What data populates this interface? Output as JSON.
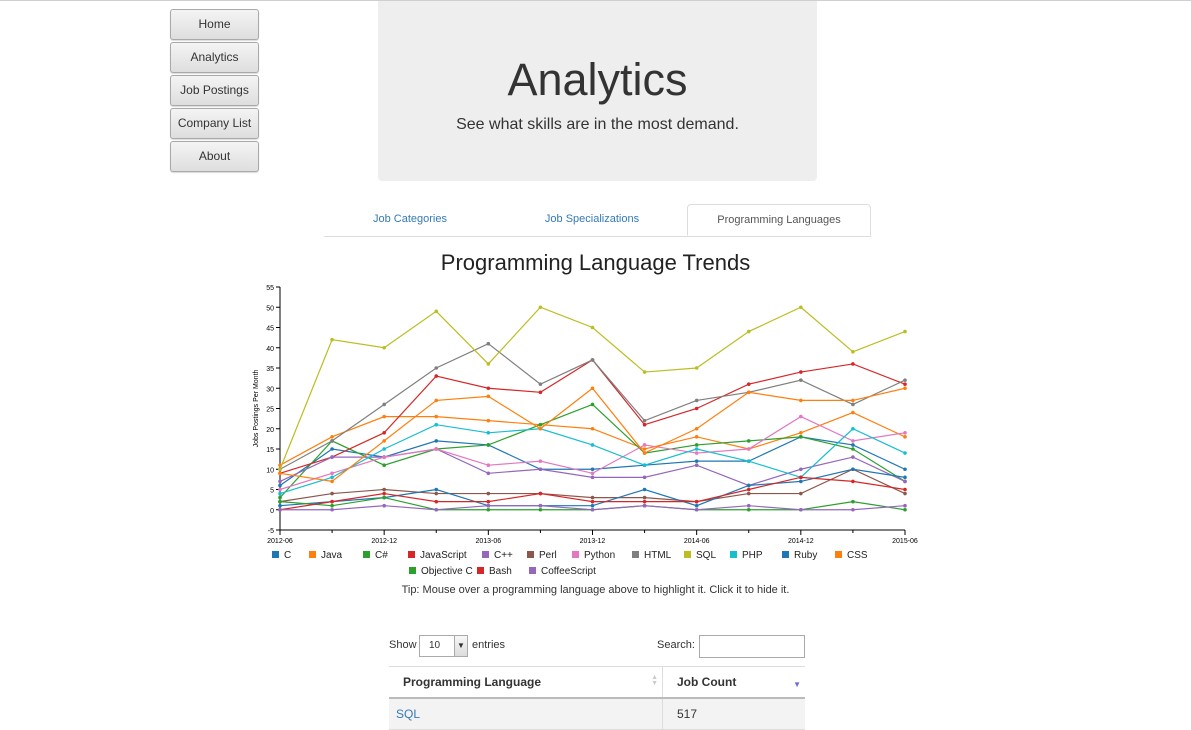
{
  "nav": {
    "items": [
      "Home",
      "Analytics",
      "Job Postings",
      "Company List",
      "About"
    ]
  },
  "hero": {
    "title": "Analytics",
    "subtitle": "See what skills are in the most demand."
  },
  "tabs": [
    {
      "label": "Job Categories",
      "active": false
    },
    {
      "label": "Job Specializations",
      "active": false
    },
    {
      "label": "Programming Languages",
      "active": true
    }
  ],
  "chart_data": {
    "type": "line",
    "title": "Programming Language Trends",
    "ylabel": "Jobs Postings Per Month",
    "xlabel": "",
    "ylim": [
      -5,
      55
    ],
    "yticks": [
      -5,
      0,
      5,
      10,
      15,
      20,
      25,
      30,
      35,
      40,
      45,
      50,
      55
    ],
    "xlim": [
      "2012-06",
      "2015-06"
    ],
    "xticks": [
      "2012-06",
      "2012-12",
      "2013-06",
      "2013-12",
      "2014-06",
      "2014-12",
      "2015-06"
    ],
    "x": [
      "2012-06",
      "2012-09",
      "2012-12",
      "2013-03",
      "2013-06",
      "2013-09",
      "2013-12",
      "2014-03",
      "2014-06",
      "2014-09",
      "2014-12",
      "2015-03",
      "2015-06"
    ],
    "legend_position": "bottom",
    "series": [
      {
        "name": "C",
        "color": "#1f77b4",
        "values": [
          6,
          15,
          13,
          17,
          16,
          10,
          10,
          11,
          12,
          12,
          18,
          16,
          10
        ]
      },
      {
        "name": "Java",
        "color": "#ff7f0e",
        "values": [
          11,
          18,
          23,
          23,
          22,
          21,
          20,
          15,
          18,
          15,
          19,
          24,
          18
        ]
      },
      {
        "name": "C#",
        "color": "#2ca02c",
        "values": [
          3,
          17,
          11,
          15,
          16,
          21,
          26,
          14,
          16,
          17,
          18,
          15,
          7
        ]
      },
      {
        "name": "JavaScript",
        "color": "#d62728",
        "values": [
          9,
          13,
          19,
          33,
          30,
          29,
          37,
          21,
          25,
          31,
          34,
          36,
          31
        ]
      },
      {
        "name": "C++",
        "color": "#9467bd",
        "values": [
          7,
          13,
          13,
          15,
          9,
          10,
          8,
          8,
          11,
          6,
          10,
          13,
          7
        ]
      },
      {
        "name": "Perl",
        "color": "#8c564b",
        "values": [
          2,
          4,
          5,
          4,
          4,
          4,
          3,
          3,
          2,
          4,
          4,
          10,
          4
        ]
      },
      {
        "name": "Python",
        "color": "#e377c2",
        "values": [
          5,
          9,
          13,
          15,
          11,
          12,
          9,
          16,
          14,
          15,
          23,
          17,
          19
        ]
      },
      {
        "name": "HTML",
        "color": "#7f7f7f",
        "values": [
          10,
          17,
          26,
          35,
          41,
          31,
          37,
          22,
          27,
          29,
          32,
          26,
          32
        ]
      },
      {
        "name": "SQL",
        "color": "#bcbd22",
        "values": [
          10,
          42,
          40,
          49,
          36,
          50,
          45,
          34,
          35,
          44,
          50,
          39,
          44
        ]
      },
      {
        "name": "PHP",
        "color": "#17becf",
        "values": [
          4,
          8,
          15,
          21,
          19,
          20,
          16,
          11,
          15,
          12,
          8,
          20,
          14
        ]
      },
      {
        "name": "Ruby",
        "color": "#1f77b4",
        "values": [
          1,
          2,
          3,
          5,
          1,
          1,
          1,
          5,
          1,
          6,
          7,
          10,
          8
        ]
      },
      {
        "name": "CSS",
        "color": "#ff7f0e",
        "values": [
          9,
          7,
          17,
          27,
          28,
          20,
          30,
          14,
          20,
          29,
          27,
          27,
          30
        ]
      },
      {
        "name": "Objective C",
        "color": "#2ca02c",
        "values": [
          2,
          1,
          3,
          0,
          0,
          0,
          0,
          1,
          0,
          0,
          0,
          2,
          0
        ]
      },
      {
        "name": "Bash",
        "color": "#d62728",
        "values": [
          0,
          2,
          4,
          2,
          2,
          4,
          2,
          2,
          2,
          5,
          8,
          7,
          5
        ]
      },
      {
        "name": "CoffeeScript",
        "color": "#9467bd",
        "values": [
          0,
          0,
          1,
          0,
          1,
          1,
          0,
          1,
          0,
          1,
          0,
          0,
          1
        ]
      }
    ]
  },
  "tip": "Tip: Mouse over a programming language above to highlight it. Click it to hide it.",
  "table_controls": {
    "show_label": "Show",
    "page_size": "10",
    "entries_label": "entries",
    "search_label": "Search:"
  },
  "table": {
    "columns": [
      "Programming Language",
      "Job Count"
    ],
    "rows": [
      [
        "SQL",
        "517"
      ]
    ]
  }
}
